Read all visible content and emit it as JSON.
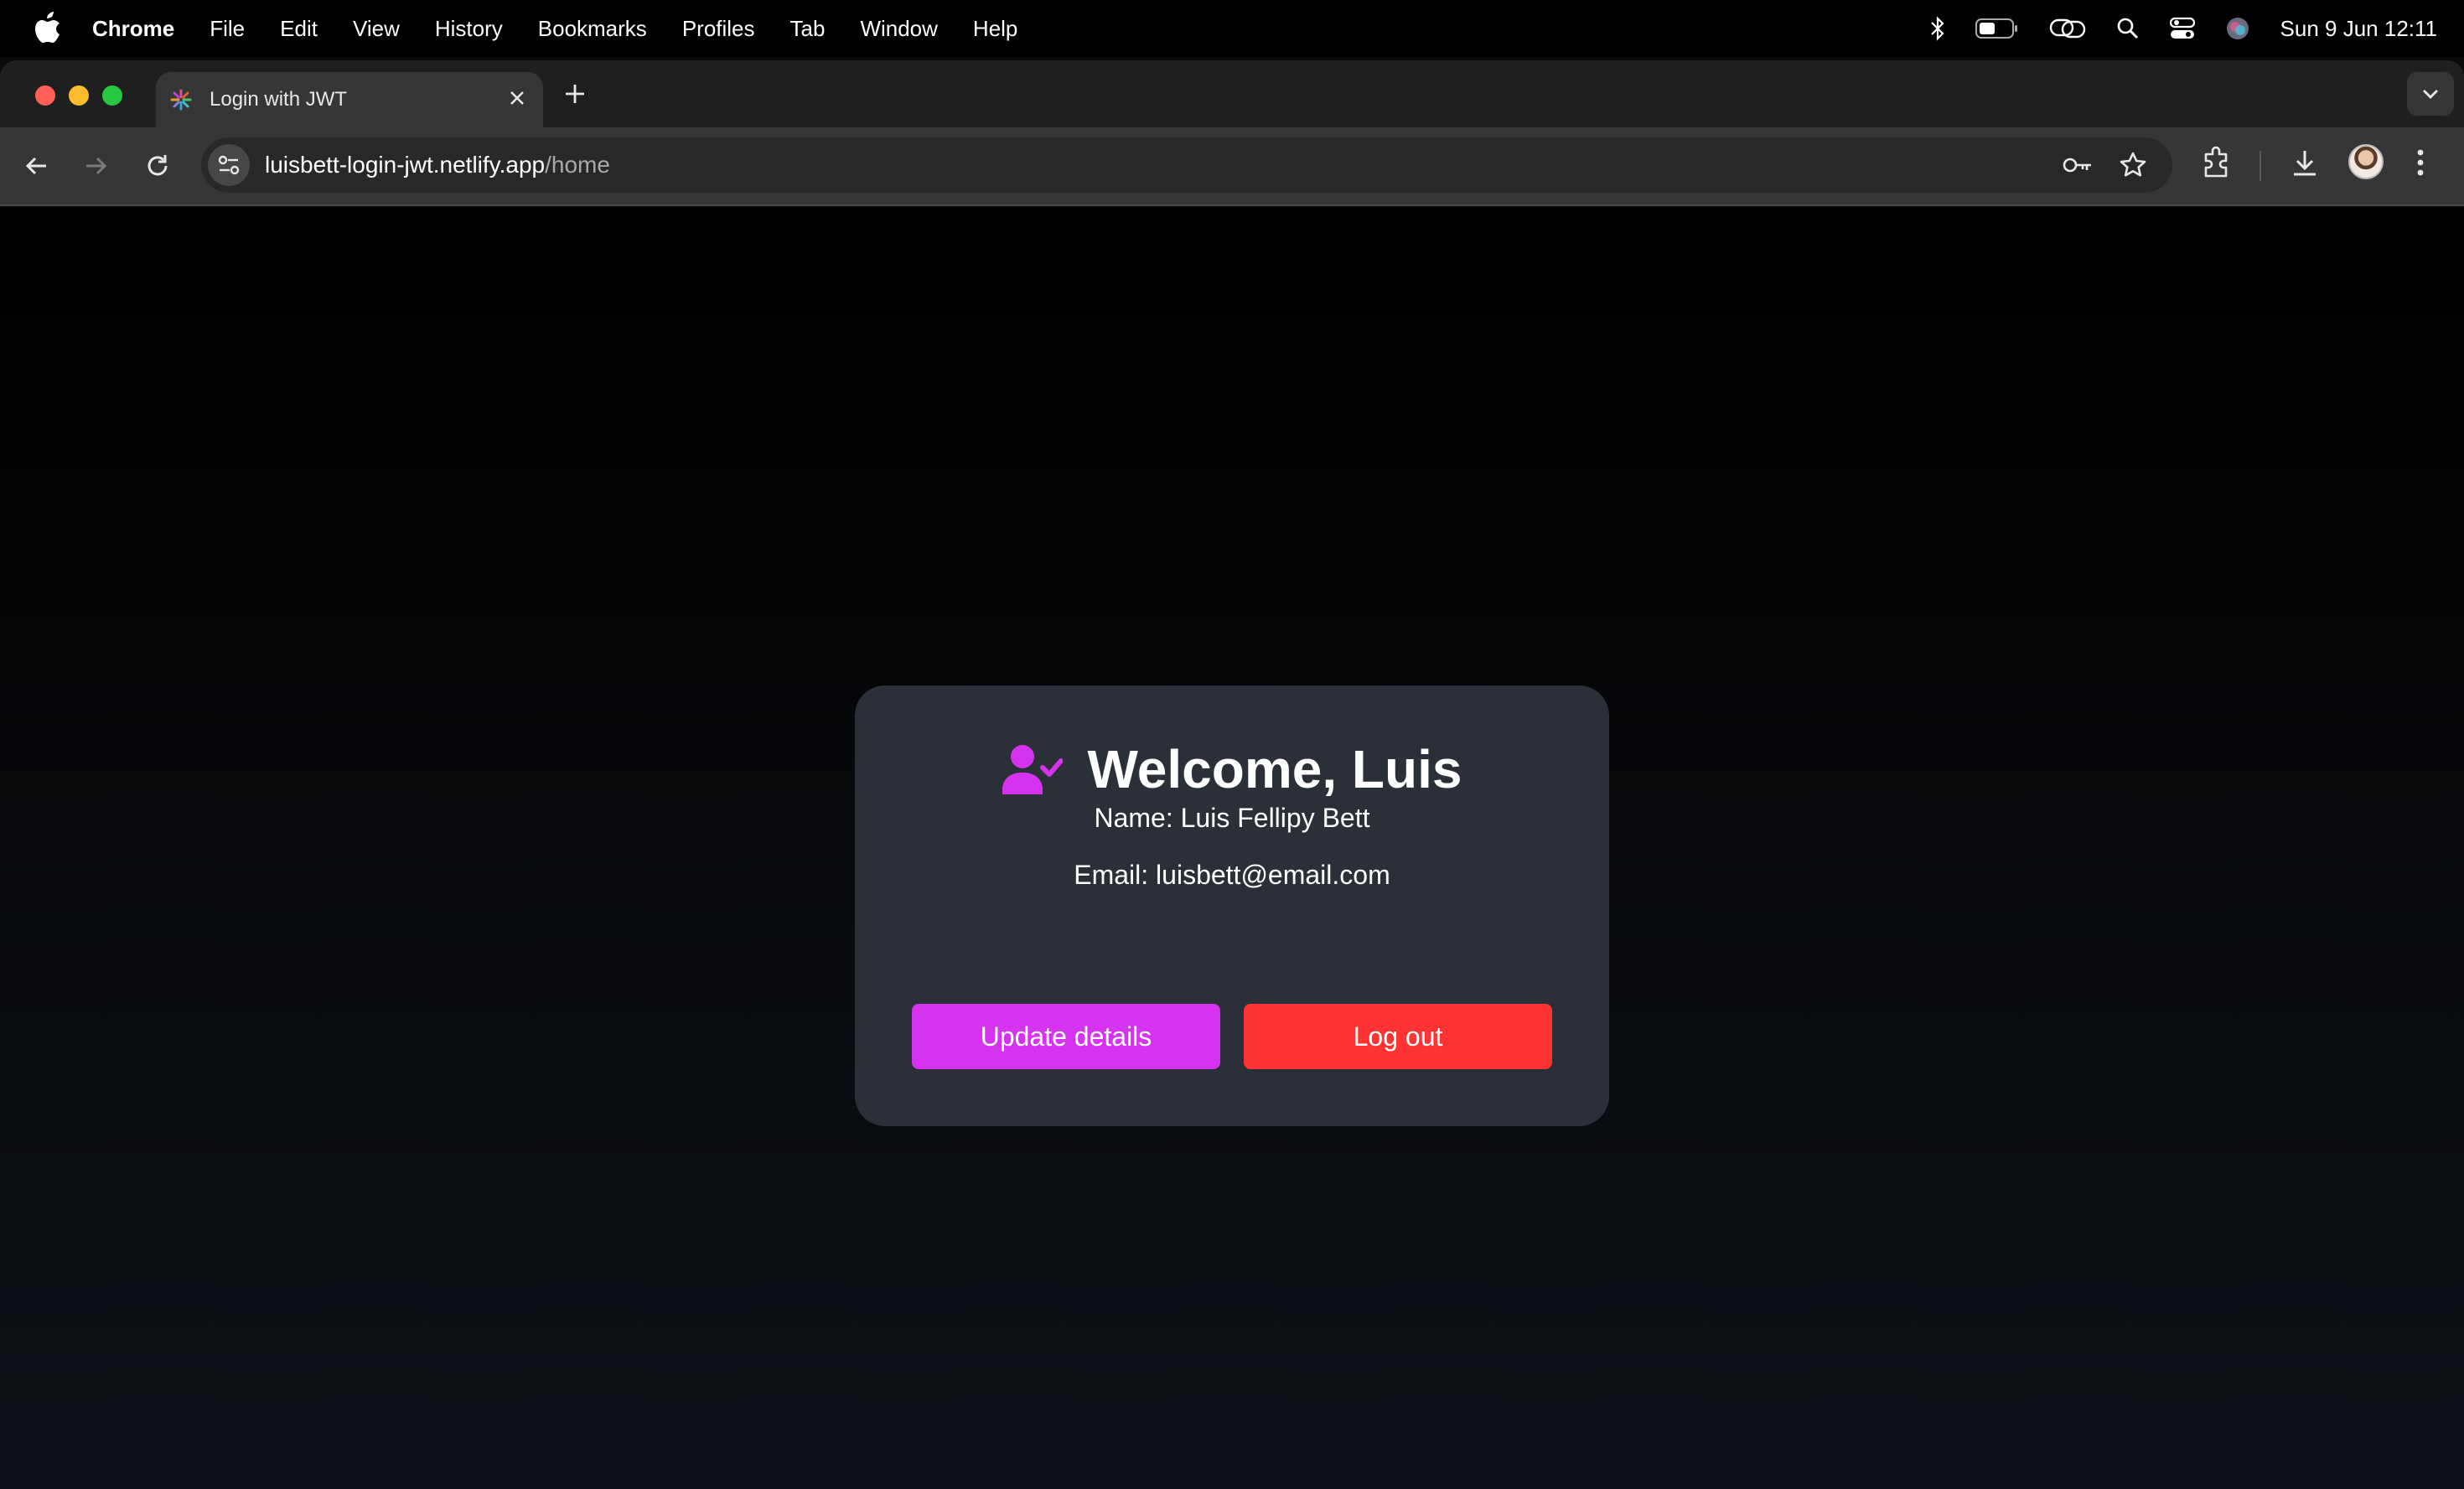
{
  "menubar": {
    "app_name": "Chrome",
    "items": [
      "File",
      "Edit",
      "View",
      "History",
      "Bookmarks",
      "Profiles",
      "Tab",
      "Window",
      "Help"
    ],
    "clock": "Sun 9 Jun  12:11",
    "status_icons": [
      "bluetooth-icon",
      "battery-icon",
      "screen-mirroring-icon",
      "spotlight-search-icon",
      "control-center-icon",
      "siri-icon"
    ]
  },
  "browser": {
    "tab_title": "Login with JWT",
    "url_host": "luisbett-login-jwt.netlify.app",
    "url_path": "/home"
  },
  "page": {
    "welcome_title": "Welcome, Luis",
    "name_line": "Name: Luis Fellipy Bett",
    "email_line": "Email: luisbett@email.com",
    "update_button": "Update details",
    "logout_button": "Log out",
    "colors": {
      "accent_purple": "#d633f0",
      "danger_red": "#ff3333",
      "card_bg": "#2b2f37"
    }
  }
}
